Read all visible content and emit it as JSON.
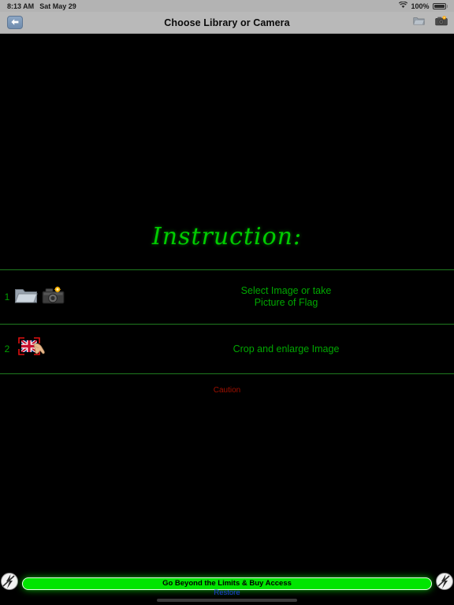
{
  "status_bar": {
    "time": "8:13 AM",
    "date": "Sat May 29",
    "battery_percent": "100%",
    "wifi_icon": "wifi-icon",
    "battery_icon": "battery-full-icon"
  },
  "nav_bar": {
    "title": "Choose Library or Camera",
    "back_icon": "back-arrow-icon",
    "folder_icon": "folder-icon",
    "camera_icon": "camera-icon"
  },
  "main": {
    "heading": "Instruction:",
    "steps": [
      {
        "number": "1",
        "label": "Select Image or take\nPicture of Flag",
        "label_line1": "Select Image or take",
        "label_line2": "Picture of Flag",
        "icons": [
          "folder-icon",
          "camera-flash-icon"
        ]
      },
      {
        "number": "2",
        "label": "Crop and enlarge Image",
        "icons": [
          "crop-flag-hand-icon"
        ]
      }
    ],
    "caution": "Caution"
  },
  "bottom_bar": {
    "buy_button": "Go Beyond the Limits & Buy Access",
    "restore_link": "Restore",
    "left_badge_icon": "slashed-circle-badge-icon",
    "right_badge_icon": "slashed-circle-badge-icon"
  },
  "colors": {
    "background": "#000000",
    "accent_green": "#00a700",
    "heading_green": "#00cc00",
    "divider_green": "#1f7a1f",
    "buy_green": "#00e500",
    "caution_red": "#a01000",
    "restore_blue": "#2040e0",
    "chrome_gray": "#b9b9b9"
  }
}
